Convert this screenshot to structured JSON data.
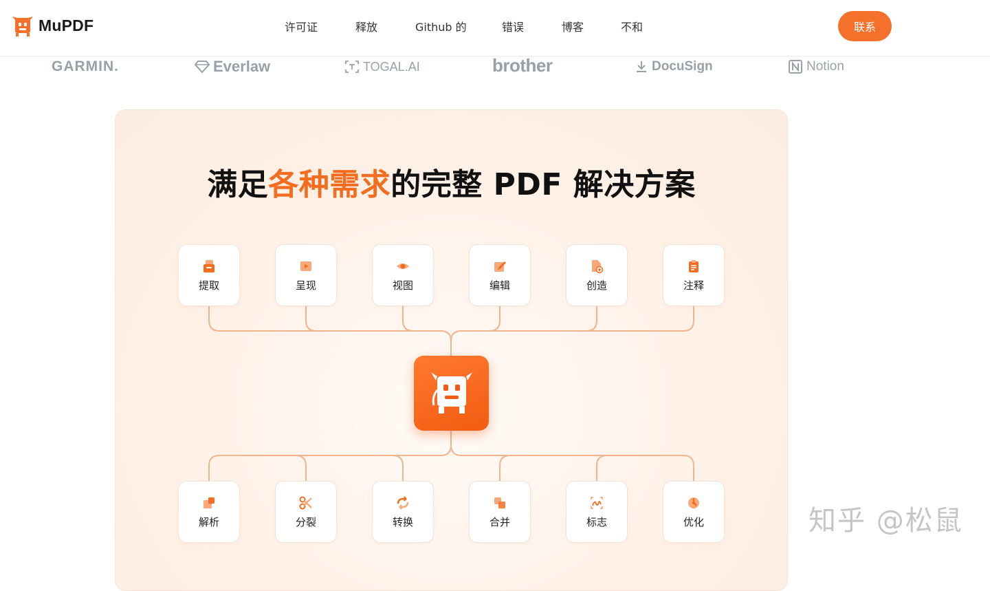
{
  "header": {
    "brand": "MuPDF",
    "nav": [
      "许可证",
      "释放",
      "Github 的",
      "错误",
      "博客",
      "不和"
    ],
    "contact_label": "联系"
  },
  "logos": [
    "GARMIN.",
    "Everlaw",
    "TOGAL.AI",
    "brother",
    "DocuSign",
    "Notion"
  ],
  "hero": {
    "headline_pre": "满足",
    "headline_highlight": "各种需求",
    "headline_post": "的完整 PDF 解决方案"
  },
  "features_top": [
    {
      "label": "提取",
      "icon": "extract-icon"
    },
    {
      "label": "呈现",
      "icon": "render-icon"
    },
    {
      "label": "视图",
      "icon": "eye-icon"
    },
    {
      "label": "编辑",
      "icon": "edit-icon"
    },
    {
      "label": "创造",
      "icon": "create-icon"
    },
    {
      "label": "注释",
      "icon": "annotate-icon"
    }
  ],
  "features_bottom": [
    {
      "label": "解析",
      "icon": "parse-icon"
    },
    {
      "label": "分裂",
      "icon": "scissors-icon"
    },
    {
      "label": "转换",
      "icon": "convert-icon"
    },
    {
      "label": "合并",
      "icon": "merge-icon"
    },
    {
      "label": "标志",
      "icon": "sign-icon"
    },
    {
      "label": "优化",
      "icon": "optimize-icon"
    }
  ],
  "watermark": "知乎 @松鼠",
  "colors": {
    "accent": "#f5702a",
    "logo_gray": "#9aa0a8",
    "card_bg": "#fff1e7"
  }
}
